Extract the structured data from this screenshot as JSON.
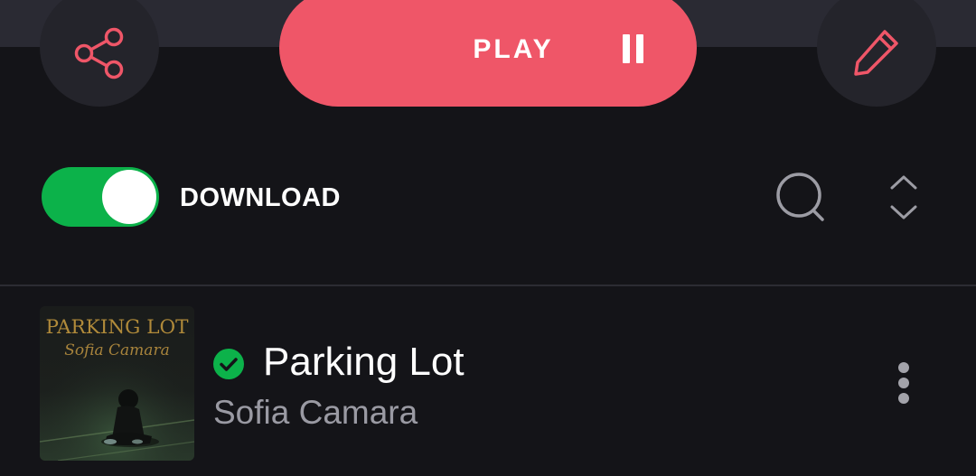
{
  "header": {
    "share_icon": "share-icon",
    "play_label": "PLAY",
    "pause_icon": "pause-icon",
    "edit_icon": "pencil-icon"
  },
  "controls": {
    "download_label": "DOWNLOAD",
    "download_enabled": true,
    "search_icon": "search-icon",
    "sort_icon": "sort-chevrons-icon"
  },
  "tracks": [
    {
      "title": "Parking Lot",
      "artist": "Sofia Camara",
      "downloaded": true,
      "art_title": "PARKING LOT",
      "art_signature": "Sofia Camara"
    }
  ],
  "colors": {
    "accent": "#ef5668",
    "toggle_on": "#0cb24a",
    "background": "#141418",
    "muted_text": "#9a9aa3"
  }
}
